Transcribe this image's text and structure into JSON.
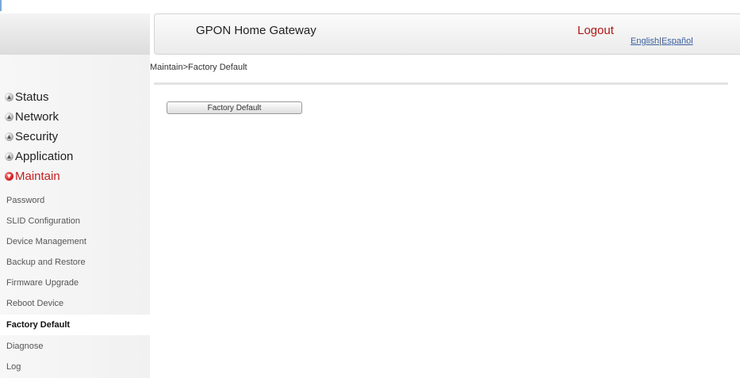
{
  "header": {
    "title": "GPON Home Gateway",
    "logout_label": "Logout",
    "lang_english": "English",
    "lang_separator": "|",
    "lang_spanish": "Español"
  },
  "breadcrumb": "Maintain>Factory Default",
  "sidebar": {
    "groups": [
      {
        "label": "Status",
        "icon": "expand-icon",
        "active": false
      },
      {
        "label": "Network",
        "icon": "expand-icon",
        "active": false
      },
      {
        "label": "Security",
        "icon": "expand-icon",
        "active": false
      },
      {
        "label": "Application",
        "icon": "expand-icon",
        "active": false
      },
      {
        "label": "Maintain",
        "icon": "collapse-icon",
        "active": true
      }
    ],
    "maintain_items": [
      {
        "label": "Password"
      },
      {
        "label": "SLID Configuration"
      },
      {
        "label": "Device Management"
      },
      {
        "label": "Backup and Restore"
      },
      {
        "label": "Firmware Upgrade"
      },
      {
        "label": "Reboot Device"
      },
      {
        "label": "Factory Default",
        "selected": true
      },
      {
        "label": "Diagnose"
      },
      {
        "label": "Log"
      }
    ]
  },
  "main": {
    "factory_default_button": "Factory Default"
  },
  "colors": {
    "accent_red": "#c41e1e",
    "link_blue": "#3a5fa0"
  }
}
